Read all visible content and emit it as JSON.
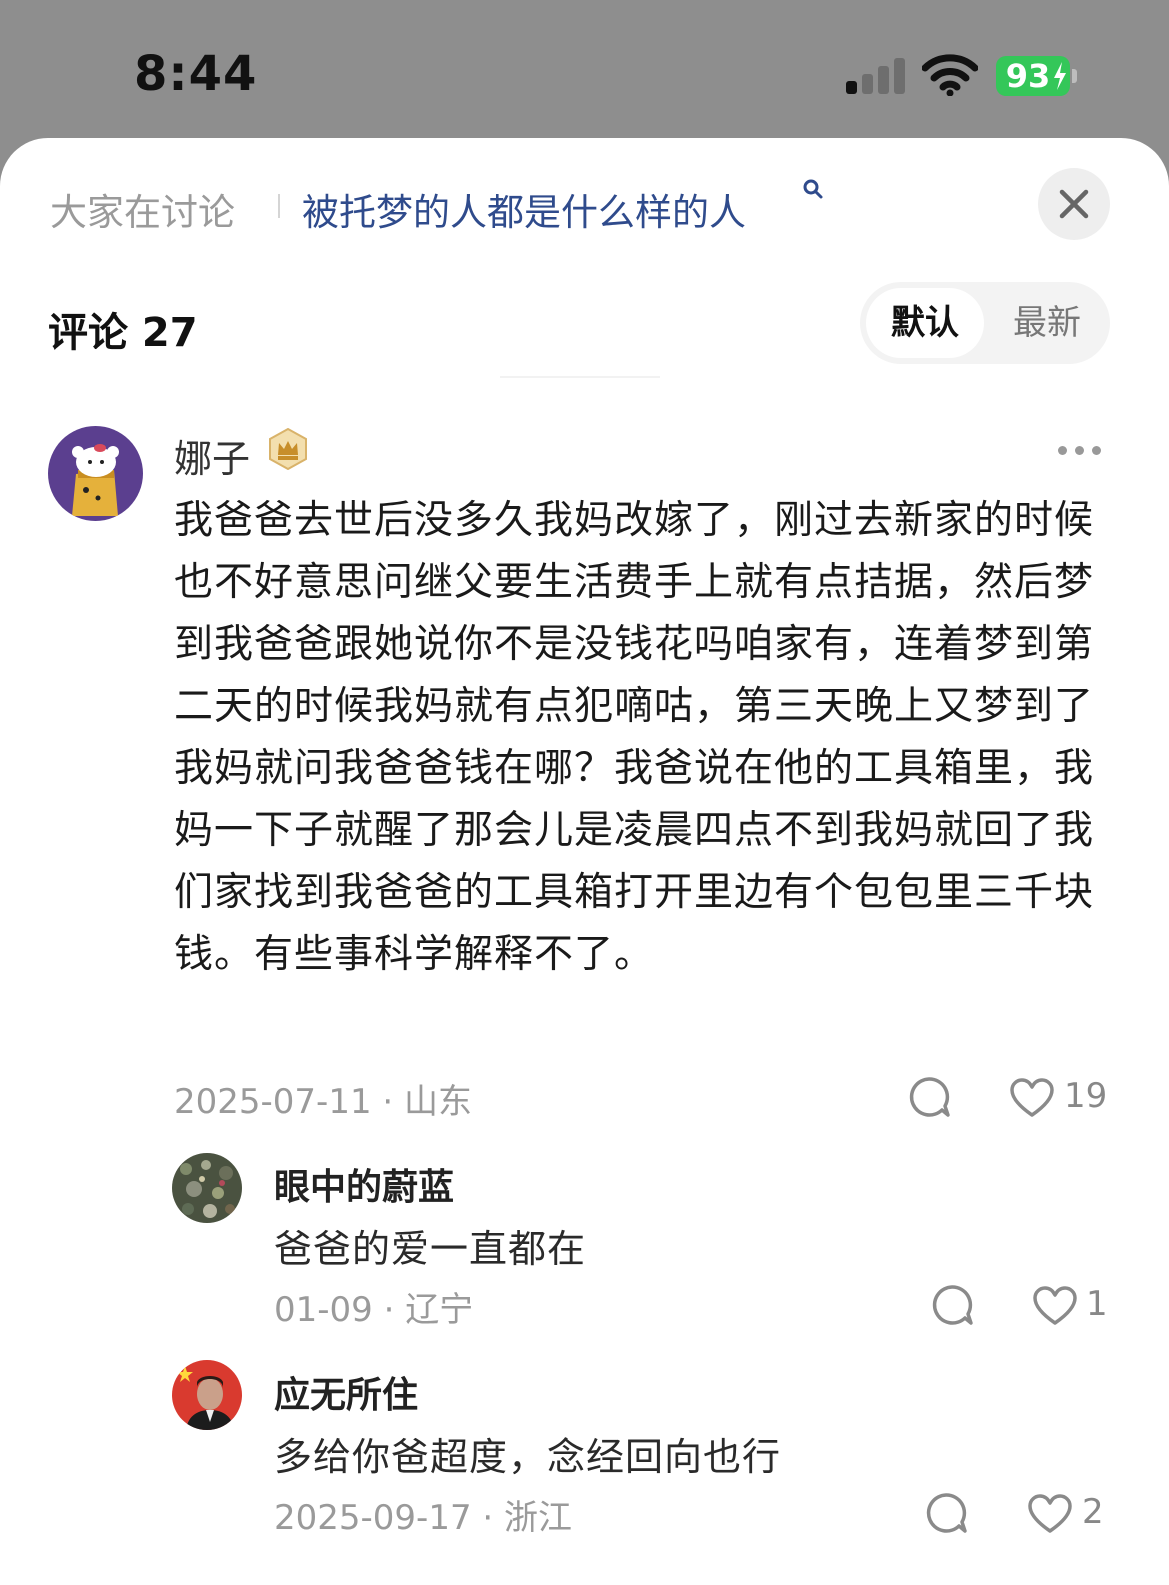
{
  "status_bar": {
    "time": "8:44",
    "battery": "93",
    "battery_color": "#34c759",
    "icons": [
      "cellular-signal-icon",
      "wifi-icon",
      "battery-charging-icon"
    ]
  },
  "topic": {
    "prefix": "大家在讨论",
    "link": "被托梦的人都是什么样的人",
    "link_color": "#2f4b8c"
  },
  "comments_header": {
    "title": "评论 27",
    "sort_options": [
      {
        "label": "默认",
        "selected": true
      },
      {
        "label": "最新",
        "selected": false
      }
    ]
  },
  "main_comment": {
    "username": "娜子",
    "badge": "crown-icon",
    "text": "我爸爸去世后没多久我妈改嫁了，刚过去新家的时候也不好意思问继父要生活费手上就有点拮据，然后梦到我爸爸跟她说你不是没钱花吗咱家有，连着梦到第二天的时候我妈就有点犯嘀咕，第三天晚上又梦到了我妈就问我爸爸钱在哪？我爸说在他的工具箱里，我妈一下子就醒了那会儿是凌晨四点不到我妈就回了我们家找到我爸爸的工具箱打开里边有个包包里三千块钱。有些事科学解释不了。",
    "meta": "2025-07-11 · 山东",
    "likes": "19"
  },
  "replies": [
    {
      "username": "眼中的蔚蓝",
      "text": "爸爸的爱一直都在",
      "meta": "01-09 · 辽宁",
      "likes": "1"
    },
    {
      "username": "应无所住",
      "text": "多给你爸超度，念经回向也行",
      "meta": "2025-09-17 · 浙江",
      "likes": "2"
    }
  ]
}
